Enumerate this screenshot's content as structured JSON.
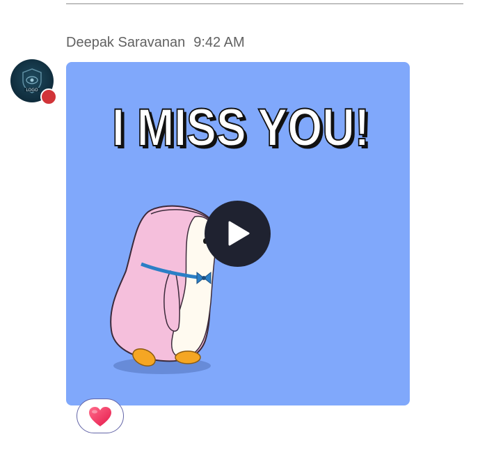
{
  "message": {
    "author": "Deepak Saravanan",
    "time": "9:42 AM",
    "status_color": "#d13438",
    "avatar_icon": "shield-logo-avatar"
  },
  "gif": {
    "caption_text": "I MISS YOU!",
    "background_color": "#80a8fb",
    "play_icon": "play-icon"
  },
  "reactions": [
    {
      "icon": "heart-icon",
      "count": ""
    }
  ]
}
